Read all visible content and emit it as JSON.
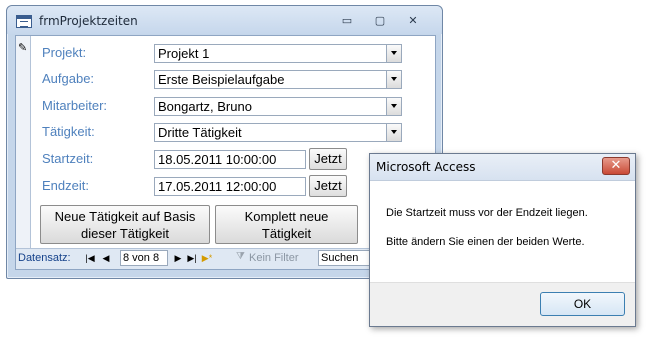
{
  "form": {
    "title": "frmProjektzeiten",
    "window_controls": {
      "minimize": "▭",
      "maximize": "▢",
      "close": "✕"
    },
    "fields": {
      "projekt": {
        "label": "Projekt:",
        "value": "Projekt 1"
      },
      "aufgabe": {
        "label": "Aufgabe:",
        "value": "Erste Beispielaufgabe"
      },
      "mitarbeiter": {
        "label": "Mitarbeiter:",
        "value": "Bongartz, Bruno"
      },
      "taetigkeit": {
        "label": "Tätigkeit:",
        "value": "Dritte Tätigkeit"
      },
      "startzeit": {
        "label": "Startzeit:",
        "value": "18.05.2011 10:00:00",
        "button": "Jetzt"
      },
      "endzeit": {
        "label": "Endzeit:",
        "value": "17.05.2011 12:00:00",
        "button": "Jetzt"
      }
    },
    "buttons": {
      "new_based_line1": "Neue Tätigkeit auf Basis",
      "new_based_line2": "dieser Tätigkeit",
      "new_complete_line1": "Komplett neue",
      "new_complete_line2": "Tätigkeit"
    },
    "navigation": {
      "label": "Datensatz:",
      "record": "8 von 8",
      "filter_label": "Kein Filter",
      "search": "Suchen",
      "icons": [
        "first-record-icon",
        "previous-record-icon",
        "next-record-icon",
        "last-record-icon",
        "new-record-icon",
        "filter-icon"
      ]
    }
  },
  "dialog": {
    "title": "Microsoft Access",
    "message_line1": "Die Startzeit muss vor der Endzeit liegen.",
    "message_line2": "Bitte ändern Sie einen der beiden Werte.",
    "ok_label": "OK",
    "close_glyph": "✕"
  },
  "colors": {
    "label_blue": "#4f81bd",
    "frame": "#c5d6ea",
    "nav_text": "#15428b",
    "close_red": "#c94a36"
  }
}
